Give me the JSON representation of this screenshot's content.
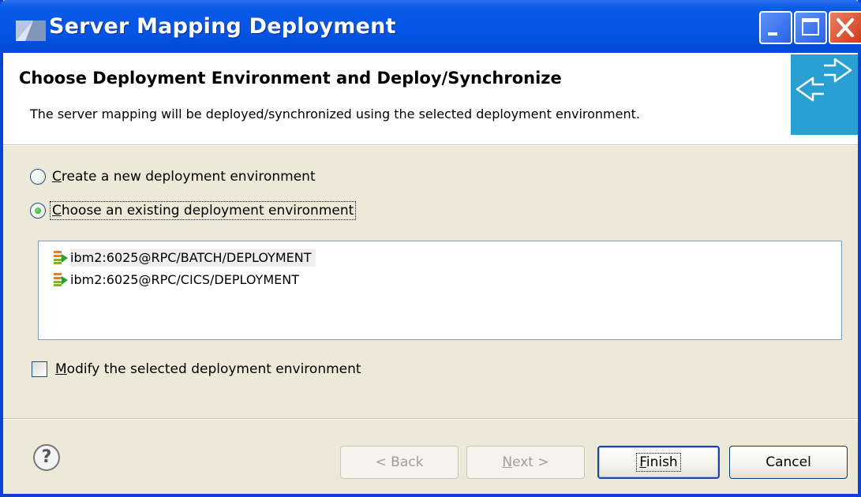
{
  "window": {
    "title": "Server Mapping Deployment",
    "controls": [
      "minimize",
      "maximize",
      "close"
    ]
  },
  "header": {
    "title": "Choose Deployment Environment and Deploy/Synchronize",
    "description": "The server mapping will be deployed/synchronized using the selected deployment environment.",
    "banner_icon": "deploy-arrows-icon"
  },
  "options": {
    "create_new": {
      "label": "Create a new deployment environment",
      "selected": false
    },
    "choose_existing": {
      "label": "Choose an existing deployment environment",
      "selected": true
    }
  },
  "environments": [
    {
      "label": "ibm2:6025@RPC/BATCH/DEPLOYMENT",
      "selected": true
    },
    {
      "label": "ibm2:6025@RPC/CICS/DEPLOYMENT",
      "selected": false
    }
  ],
  "modify": {
    "label": "Modify the selected deployment environment",
    "checked": false
  },
  "buttons": {
    "help": "?",
    "back": "< Back",
    "next": "Next >",
    "finish": "Finish",
    "cancel": "Cancel"
  },
  "colors": {
    "titlebar": "#0554e4",
    "banner": "#2a9fd1",
    "dialog_bg": "#ece9d8",
    "close": "#cf3a18"
  }
}
